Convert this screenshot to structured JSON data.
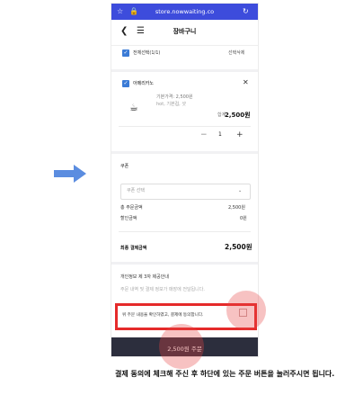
{
  "browser": {
    "url": "store.nowwaiting.co"
  },
  "header": {
    "title": "장바구니",
    "back_icon": "chevron-left-icon",
    "menu_icon": "hamburger-icon"
  },
  "selection": {
    "select_all_label": "전체선택(1/1)",
    "delete_selected_label": "선택삭제"
  },
  "cart_item": {
    "name": "아메리카노",
    "base_price": "기본가격: 2,500원",
    "options": "hot, 기본컵, 샷",
    "total_label": "합계",
    "total_value": "2,500원",
    "quantity": "1",
    "minus": "−",
    "plus": "+"
  },
  "coupon": {
    "section_label": "쿠폰",
    "select_placeholder": "쿠폰 선택"
  },
  "summary": {
    "total_order_label": "총 주문금액",
    "total_order_value": "2,500원",
    "discount_label": "할인금액",
    "discount_value": "0원",
    "final_label": "최종 결제금액",
    "final_value": "2,500원"
  },
  "privacy": {
    "title": "개인정보 제 3자 제공안내",
    "desc": "주문 내역 및 결제 정보가 매장에 전달됩니다."
  },
  "agreement": {
    "label": "위 주문 내용을 확인하였고, 결제에 동의합니다."
  },
  "pay_button": {
    "label": "2,500원 주문"
  },
  "instruction": {
    "text": "결제 동의에 체크해 주신 후 하단에 있는 주문 버튼을 눌러주시면 됩니다."
  },
  "colors": {
    "browser_bar": "#3d4cdc",
    "checkbox": "#3b7bd6",
    "highlight": "#e52a2a",
    "pay_button": "#2c2e3d",
    "arrow": "#5b8de0"
  }
}
